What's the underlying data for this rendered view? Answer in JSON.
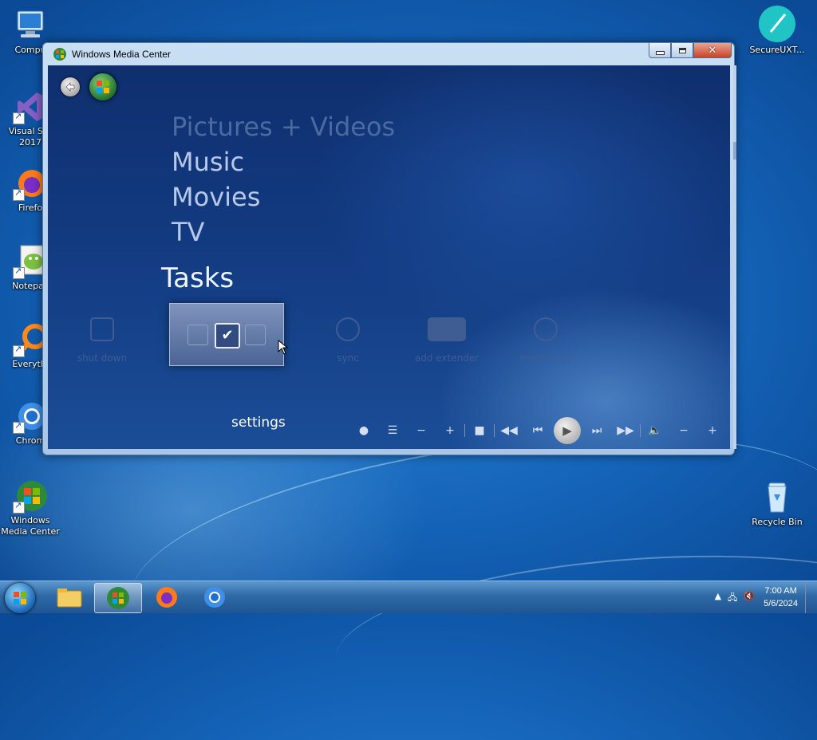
{
  "desktop": {
    "icons_left": [
      {
        "label": "Compu",
        "icon": "computer-icon"
      },
      {
        "label": "Visual Stu\n2017",
        "icon": "visual-studio-icon"
      },
      {
        "label": "Firefo",
        "icon": "firefox-icon"
      },
      {
        "label": "Notepac",
        "icon": "notepad-plus-plus-icon"
      },
      {
        "label": "Everythi",
        "icon": "everything-search-icon"
      },
      {
        "label": "Chrom",
        "icon": "chrome-icon"
      },
      {
        "label": "Windows\nMedia Center",
        "icon": "windows-media-center-icon"
      }
    ],
    "icons_right": [
      {
        "label": "SecureUXT...",
        "icon": "secure-uxt-icon"
      },
      {
        "label": "Recycle Bin",
        "icon": "recycle-bin-icon"
      }
    ]
  },
  "window": {
    "title": "Windows Media Center",
    "min_label": "minimize",
    "max_label": "maximize",
    "close_label": "close"
  },
  "wmc": {
    "menu": [
      "Pictures + Videos",
      "Music",
      "Movies",
      "TV"
    ],
    "section_title": "Tasks",
    "tasks": [
      "shut down",
      "settings",
      "sync",
      "add extender",
      "media only"
    ],
    "focused_task": "settings",
    "transport": [
      "record",
      "guide",
      "channel-down",
      "channel-up",
      "stop",
      "rewind",
      "previous",
      "play",
      "next",
      "fast-forward",
      "mute",
      "volume-down",
      "volume-up"
    ]
  },
  "taskbar": {
    "items": [
      "windows-explorer",
      "windows-media-center",
      "firefox",
      "chrome"
    ],
    "active_item": "windows-media-center",
    "time": "7:00 AM",
    "date": "5/6/2024"
  }
}
